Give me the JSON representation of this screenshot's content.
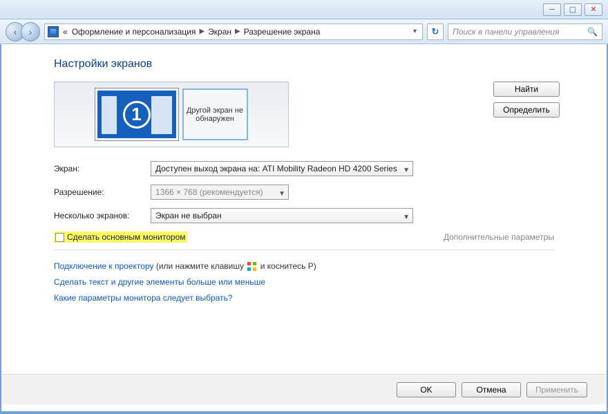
{
  "window": {
    "minimize": "─",
    "maximize": "▢",
    "close": "✕"
  },
  "nav": {
    "back": "‹",
    "forward": "›",
    "laquo": "«",
    "crumb1": "Оформление и персонализация",
    "crumb2": "Экран",
    "crumb3": "Разрешение экрана",
    "refresh": "↻",
    "search_placeholder": "Поиск в панели управления"
  },
  "page": {
    "title": "Настройки экранов",
    "monitor_number": "1",
    "placeholder_text": "Другой экран не обнаружен",
    "find_btn": "Найти",
    "detect_btn": "Определить"
  },
  "form": {
    "screen_label": "Экран:",
    "screen_value": "Доступен выход экрана на: ATI Mobility Radeon HD 4200 Series",
    "resolution_label": "Разрешение:",
    "resolution_value": "1366 × 768 (рекомендуется)",
    "multi_label": "Несколько экранов:",
    "multi_value": "Экран не выбран",
    "primary_checkbox": "Сделать основным монитором",
    "advanced": "Дополнительные параметры"
  },
  "help": {
    "projector_link": "Подключение к проектору",
    "projector_suffix_a": " (или нажмите клавишу ",
    "projector_suffix_b": " и коснитесь P)",
    "text_size": "Сделать текст и другие элементы больше или меньше",
    "which_settings": "Какие параметры монитора следует выбрать?"
  },
  "buttons": {
    "ok": "OK",
    "cancel": "Отмена",
    "apply": "Применить"
  }
}
